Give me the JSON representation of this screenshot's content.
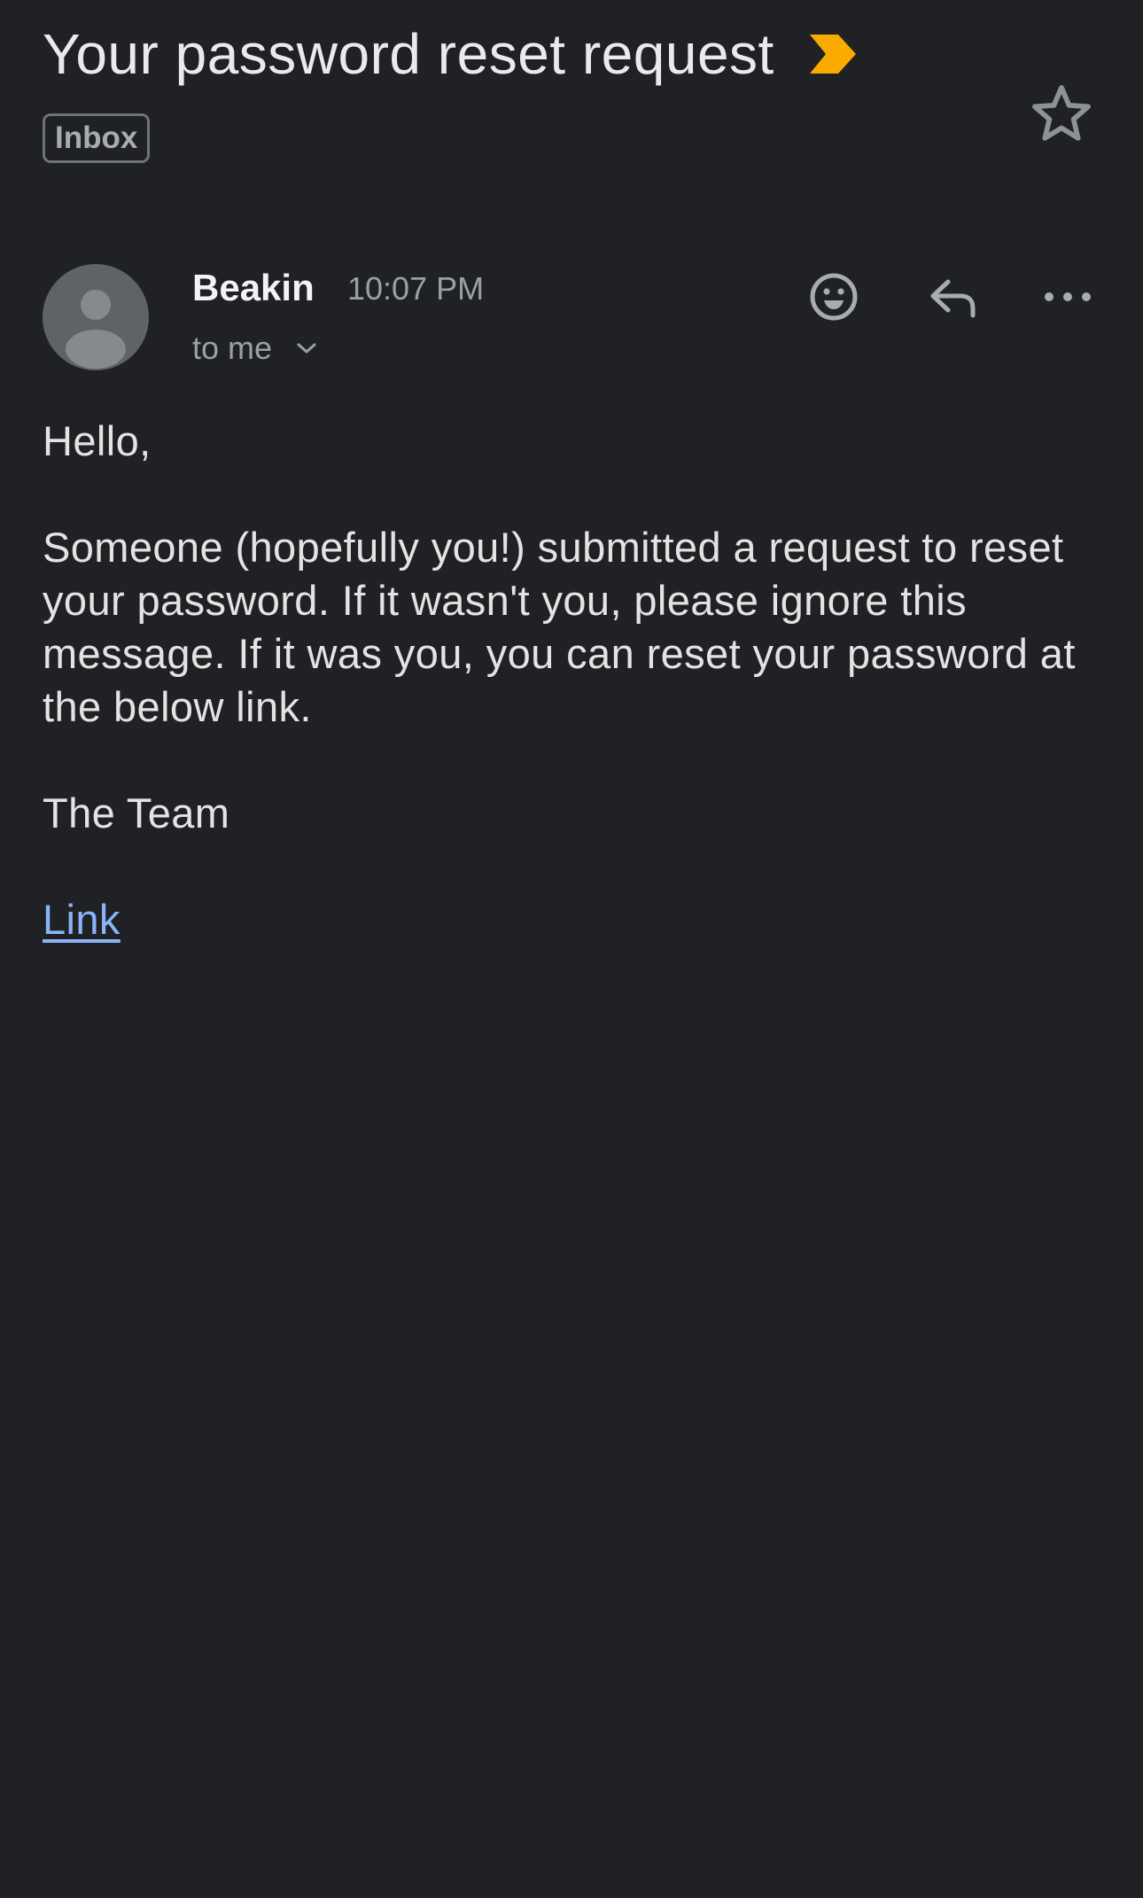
{
  "email": {
    "subject": "Your password reset request",
    "label": "Inbox",
    "sender": "Beakin",
    "time": "10:07 PM",
    "recipient": "to me",
    "body": {
      "greeting": "Hello,",
      "main": "Someone (hopefully you!) submitted a request to reset your password. If it wasn't you, please ignore this message. If it was you, you can reset your password at the below link.",
      "signoff": "The Team",
      "link_text": "Link"
    }
  },
  "icons": {
    "importance": "importance-marker-icon",
    "star": "star-outline-icon",
    "avatar": "default-avatar-icon",
    "emoji": "add-reaction-icon",
    "reply": "reply-icon",
    "more": "more-horizontal-icon",
    "expand": "chevron-down-icon"
  },
  "colors": {
    "background": "#202124",
    "importance": "#f9ab00",
    "link": "#8ab4f8",
    "secondary_text": "#9aa0a6"
  }
}
